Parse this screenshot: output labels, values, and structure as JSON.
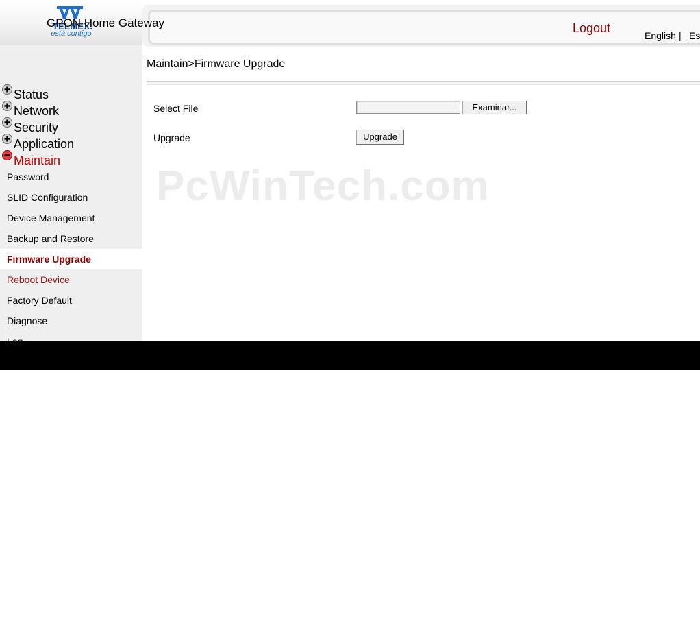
{
  "brand": {
    "name": "TELMEX.",
    "tagline": "está contigo"
  },
  "header": {
    "title": "GPON Home Gateway",
    "logout": "Logout",
    "languages": [
      "English",
      "|",
      "Es"
    ]
  },
  "sidebar": {
    "menus": [
      {
        "label": "Status",
        "icon": "plus-icon"
      },
      {
        "label": "Network",
        "icon": "plus-icon"
      },
      {
        "label": "Security",
        "icon": "plus-icon"
      },
      {
        "label": "Application",
        "icon": "plus-icon"
      },
      {
        "label": "Maintain",
        "icon": "minus-icon"
      }
    ],
    "maintain_items": [
      "Password",
      "SLID Configuration",
      "Device Management",
      "Backup and Restore",
      "Firmware Upgrade",
      "Reboot Device",
      "Factory Default",
      "Diagnose",
      "Log"
    ]
  },
  "main": {
    "breadcrumb": "Maintain>Firmware Upgrade",
    "select_file_label": "Select File",
    "file_value": "",
    "browse_label": "Examinar...",
    "upgrade_label": "Upgrade",
    "upgrade_button": "Upgrade"
  },
  "watermark": "PcWinTech.com",
  "colors": {
    "active_red": "#c00000",
    "selected_text": "#8b0000",
    "sidebar_bg": "#efefef",
    "brand_blue": "#0a3f8f"
  }
}
